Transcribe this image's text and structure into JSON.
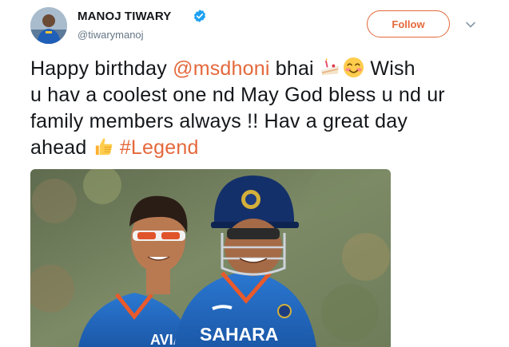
{
  "author": {
    "display_name": "MANOJ TIWARY",
    "handle": "@tiwarymanoj",
    "verified": true
  },
  "follow_button": {
    "label": "Follow"
  },
  "tweet": {
    "line1_prefix": "Happy birthday ",
    "mention": "@msdhoni",
    "line1_mid": " bhai ",
    "line1_suffix": " Wish",
    "line2": "u hav a coolest one nd May God bless u nd ur",
    "line3": "family members always !! Hav a great day",
    "line4_prefix": "ahead ",
    "hashtag": "#Legend",
    "emojis": [
      "cake-emoji",
      "blush-emoji",
      "thumbs-up-emoji"
    ]
  },
  "media": {
    "jersey_text": "SAHARA"
  },
  "colors": {
    "accent": "#e4683b",
    "verified_blue": "#1da1f2",
    "text_primary": "#14171a",
    "text_secondary": "#657786"
  }
}
